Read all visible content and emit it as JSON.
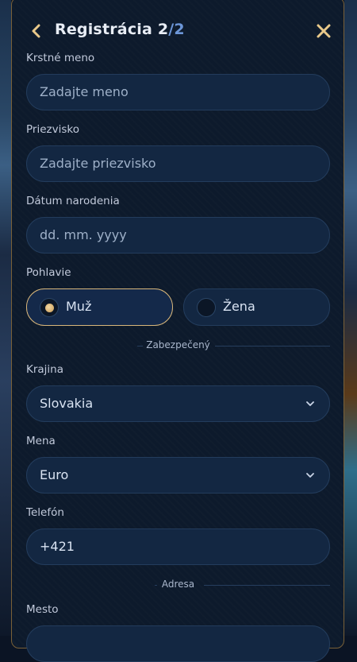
{
  "header": {
    "title": "Registrácia",
    "step_current": "2",
    "step_separator": "/",
    "step_total": "2"
  },
  "form": {
    "first_name": {
      "label": "Krstné meno",
      "placeholder": "Zadajte meno"
    },
    "last_name": {
      "label": "Priezvisko",
      "placeholder": "Zadajte priezvisko"
    },
    "birth_date": {
      "label": "Dátum narodenia",
      "placeholder": "dd. mm. yyyy"
    },
    "gender": {
      "label": "Pohlavie",
      "options": [
        {
          "label": "Muž",
          "selected": true
        },
        {
          "label": "Žena",
          "selected": false
        }
      ]
    },
    "divider_secure": "Zabezpečený",
    "country": {
      "label": "Krajina",
      "value": "Slovakia"
    },
    "currency": {
      "label": "Mena",
      "value": "Euro"
    },
    "phone": {
      "label": "Telefón",
      "value": "+421"
    },
    "divider_address": "Adresa",
    "city": {
      "label": "Mesto"
    }
  },
  "colors": {
    "accent_gold": "#d8b67a",
    "step_blue": "#6c96d8",
    "panel": "#0d1a2c",
    "field": "#132742"
  },
  "icons": {
    "back": "chevron-left-icon",
    "close": "close-icon",
    "dropdown": "chevron-down-icon"
  }
}
